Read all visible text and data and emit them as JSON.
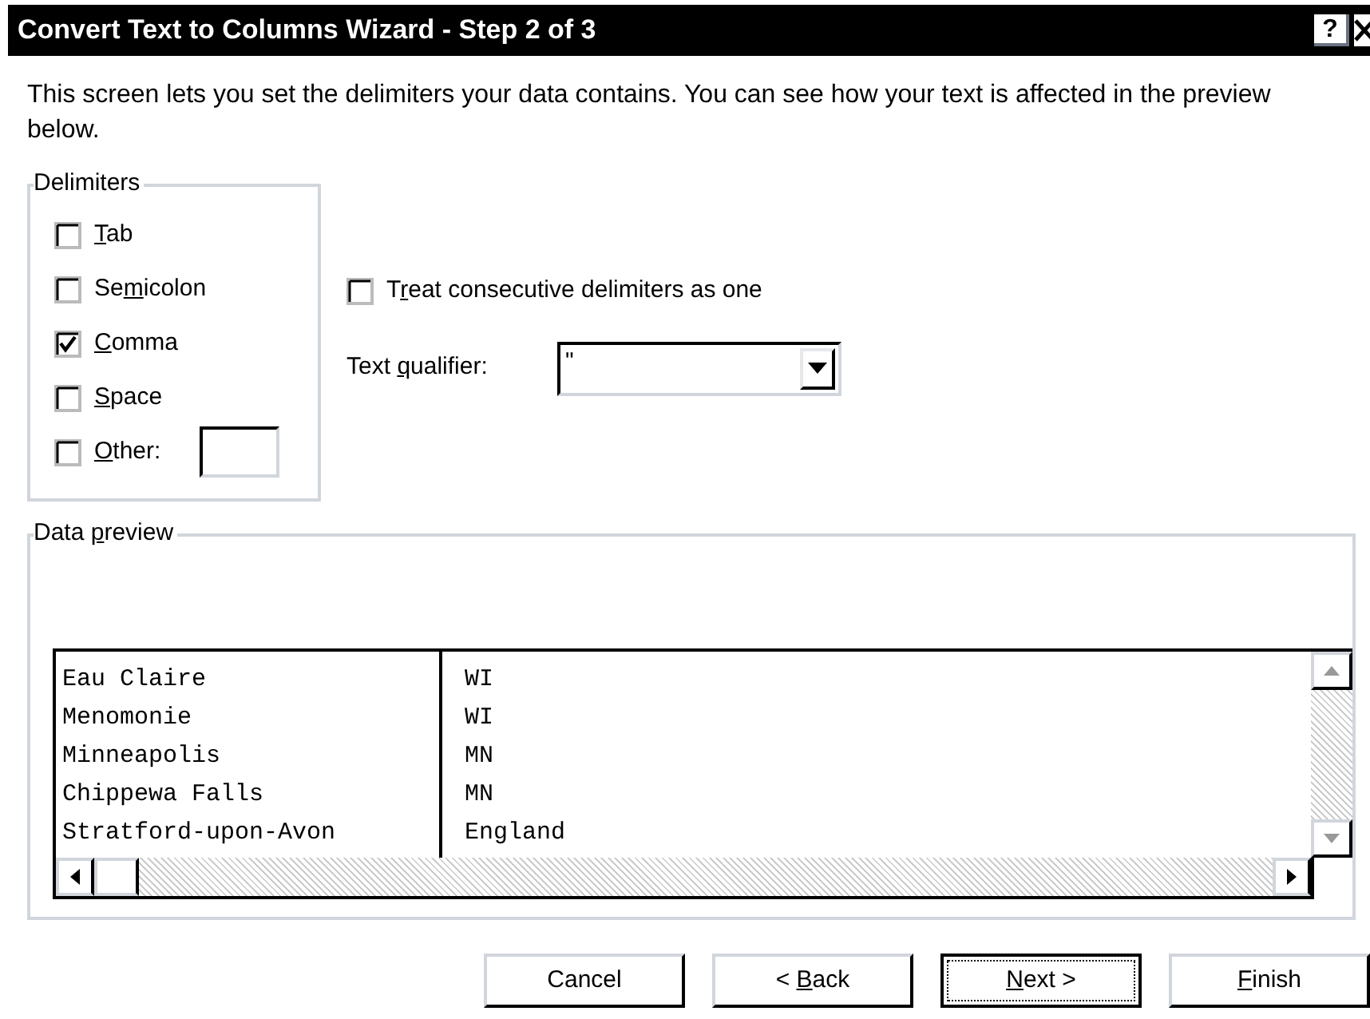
{
  "window": {
    "title": "Convert Text to Columns Wizard - Step 2 of 3",
    "help_label": "?"
  },
  "description": "This screen lets you set the delimiters your data contains.  You can see how your text is affected in the preview below.",
  "delimiters": {
    "title": {
      "pre": "Delimiters"
    },
    "items": [
      {
        "kind": "checkbox",
        "label": {
          "key": "T",
          "post": "ab"
        },
        "checked": false
      },
      {
        "kind": "checkbox",
        "label": {
          "pre": "Se",
          "key": "m",
          "post": "icolon"
        },
        "checked": false
      },
      {
        "kind": "checkbox",
        "label": {
          "key": "C",
          "post": "omma"
        },
        "checked": true
      },
      {
        "kind": "checkbox",
        "label": {
          "key": "S",
          "post": "pace"
        },
        "checked": false
      },
      {
        "kind": "checkbox_with_field",
        "label": {
          "key": "O",
          "post": "ther:"
        },
        "checked": false
      }
    ]
  },
  "consecutive": {
    "label": {
      "pre": "T",
      "key": "r",
      "post": "eat consecutive delimiters as one"
    },
    "checked": false
  },
  "text_qualifier": {
    "label": {
      "pre": "Text ",
      "key": "q",
      "post": "ualifier:"
    },
    "value": "\""
  },
  "data_preview": {
    "title": {
      "pre": "Data ",
      "key": "p",
      "post": "review"
    },
    "rows": [
      [
        "Eau Claire",
        "WI"
      ],
      [
        "Menomonie",
        "WI"
      ],
      [
        "Minneapolis",
        "MN"
      ],
      [
        "Chippewa Falls",
        "MN"
      ],
      [
        "Stratford-upon-Avon",
        "England"
      ]
    ]
  },
  "buttons": [
    {
      "label": {
        "pre": "Cancel"
      },
      "default": false
    },
    {
      "label": {
        "pre": "< ",
        "key": "B",
        "post": "ack"
      },
      "default": false
    },
    {
      "label": {
        "key": "N",
        "post": "ext >"
      },
      "default": true
    },
    {
      "label": {
        "key": "F",
        "post": "inish"
      },
      "default": false
    }
  ]
}
